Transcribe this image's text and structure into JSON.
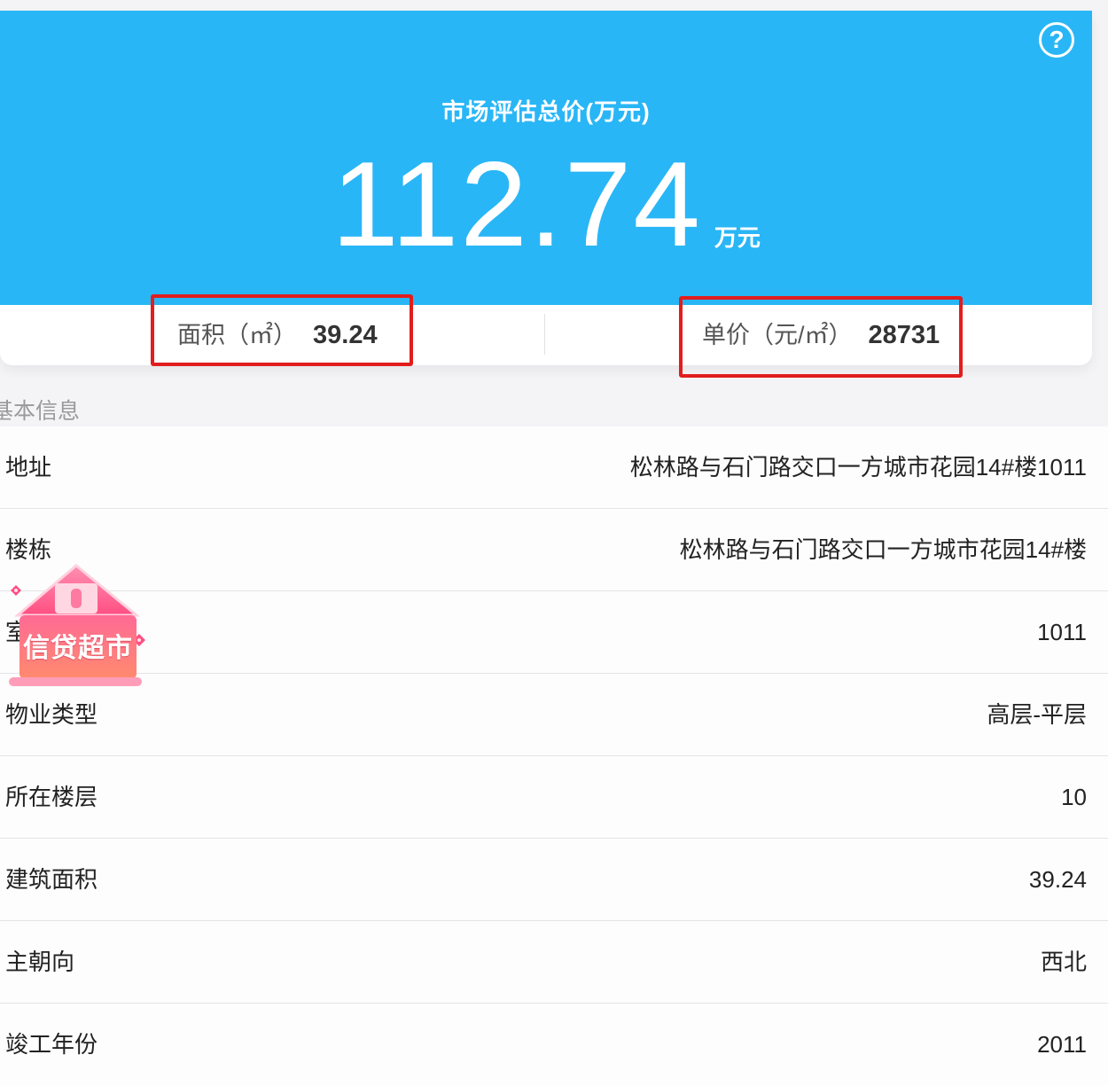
{
  "hero": {
    "title": "市场评估总价(万元)",
    "total_price": "112.74",
    "total_unit": "万元",
    "help_glyph": "?",
    "area_label": "面积（㎡）",
    "area_value": "39.24",
    "unit_price_label": "单价（元/㎡）",
    "unit_price_value": "28731"
  },
  "section": {
    "title": "基本信息"
  },
  "info": [
    {
      "label": "地址",
      "value": "松林路与石门路交口一方城市花园14#楼1011"
    },
    {
      "label": "楼栋",
      "value": "松林路与石门路交口一方城市花园14#楼"
    },
    {
      "label": "室号",
      "value": "1011"
    },
    {
      "label": "物业类型",
      "value": "高层-平层"
    },
    {
      "label": "所在楼层",
      "value": "10"
    },
    {
      "label": "建筑面积",
      "value": "39.24"
    },
    {
      "label": "主朝向",
      "value": "西北"
    },
    {
      "label": "竣工年份",
      "value": "2011"
    }
  ],
  "promo": {
    "text": "信贷超市",
    "icon": "house-icon"
  },
  "colors": {
    "hero_blue": "#29b6f6",
    "highlight_red": "#e21d1d",
    "promo_pink": "#ff5d8a"
  }
}
